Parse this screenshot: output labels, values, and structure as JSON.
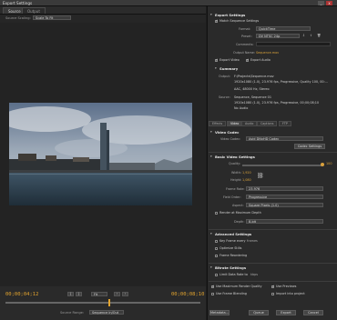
{
  "window": {
    "title": "Export Settings",
    "minimize": "_",
    "close": "x"
  },
  "left_tabs": [
    {
      "label": "Source"
    },
    {
      "label": "Output"
    }
  ],
  "source": {
    "scaling_label": "Source Scaling:",
    "scaling_value": "Scale To Fit"
  },
  "timeline": {
    "in_time": "00;00;04;12",
    "out_time": "00;00;08;10",
    "zoom_value": "Fit",
    "source_range_label": "Source Range:",
    "source_range_value": "Sequence In/Out",
    "playhead_position": 0.53
  },
  "export_settings": {
    "header": "Export Settings",
    "match_sequence_label": "Match Sequence Settings",
    "format_label": "Format:",
    "format_value": "QuickTime",
    "preset_label": "Preset:",
    "preset_value": "DV NTSC 24p",
    "comments_label": "Comments:",
    "output_name_label": "Output Name:",
    "output_name_value": "Sequence.mov",
    "export_video_label": "Export Video",
    "export_audio_label": "Export Audio",
    "summary_header": "Summary",
    "output_label": "Output:",
    "output_lines": [
      "F:\\Projects\\Sequence.mov",
      "1920x1080 (1.0), 23.976 fps, Progressive, Quality 100, 00:...",
      "AAC, 48000 Hz, Stereo"
    ],
    "source_label": "Source:",
    "source_lines": [
      "Sequence, Sequence 01",
      "1920x1080 (1.0), 23.976 fps, Progressive, 00;00;08;10",
      "No Audio"
    ]
  },
  "panel_tabs": [
    "Effects",
    "Video",
    "Audio",
    "Captions",
    "FTP"
  ],
  "video_codec": {
    "header": "Video Codec",
    "codec_label": "Video Codec:",
    "codec_value": "Avid DNxHD Codec",
    "codec_settings_button": "Codec Settings"
  },
  "basic_video": {
    "header": "Basic Video Settings",
    "quality_label": "Quality:",
    "quality_value": "100",
    "quality_level": 1.0,
    "width_label": "Width:",
    "width_value": "1,920",
    "height_label": "Height:",
    "height_value": "1,080",
    "frame_rate_label": "Frame Rate:",
    "frame_rate_value": "23.976",
    "field_order_label": "Field Order:",
    "field_order_value": "Progressive",
    "aspect_label": "Aspect:",
    "aspect_value": "Square Pixels (1.0)",
    "max_depth_label": "Render at Maximum Depth",
    "depth_label": "Depth:",
    "depth_value": "8-bit"
  },
  "advanced": {
    "header": "Advanced Settings",
    "key_frame_label": "Key Frame every",
    "key_frame_value": "frames",
    "optimize_label": "Optimize Stills",
    "frame_reorder_label": "Frame Reordering"
  },
  "bitrate": {
    "header": "Bitrate Settings",
    "limit_label": "Limit Data Rate to",
    "limit_value": "kbps"
  },
  "render": {
    "max_render_quality": "Use Maximum Render Quality",
    "use_previews": "Use Previews",
    "frame_blending": "Use Frame Blending",
    "import_project": "Import into project"
  },
  "footer": {
    "metadata_button": "Metadata...",
    "queue_button": "Queue",
    "export_button": "Export",
    "cancel_button": "Cancel"
  },
  "colors": {
    "accent": "#e3a42e",
    "bg": "#1e1e1e",
    "panel": "#2a2a2a"
  }
}
